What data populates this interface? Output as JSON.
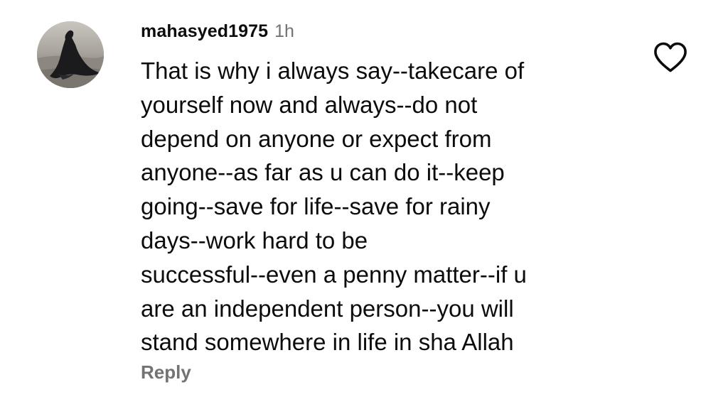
{
  "comment": {
    "username": "mahasyed1975",
    "timestamp": "1h",
    "text_lines": [
      "That is why i always say--takecare of",
      "yourself now and always--do not",
      "depend on anyone or expect from",
      "anyone--as far as u can do it--keep",
      "going--save for life--save for rainy",
      "days--work hard to be",
      "successful--even a penny matter--if u",
      "are an independent person--you will",
      "stand somewhere in life in sha Allah"
    ],
    "reply_label": "Reply",
    "like_icon": "heart-outline-icon",
    "avatar_icon": "profile-photo"
  },
  "colors": {
    "text_primary": "#0c0c0c",
    "text_secondary": "#737373",
    "background": "#ffffff"
  }
}
